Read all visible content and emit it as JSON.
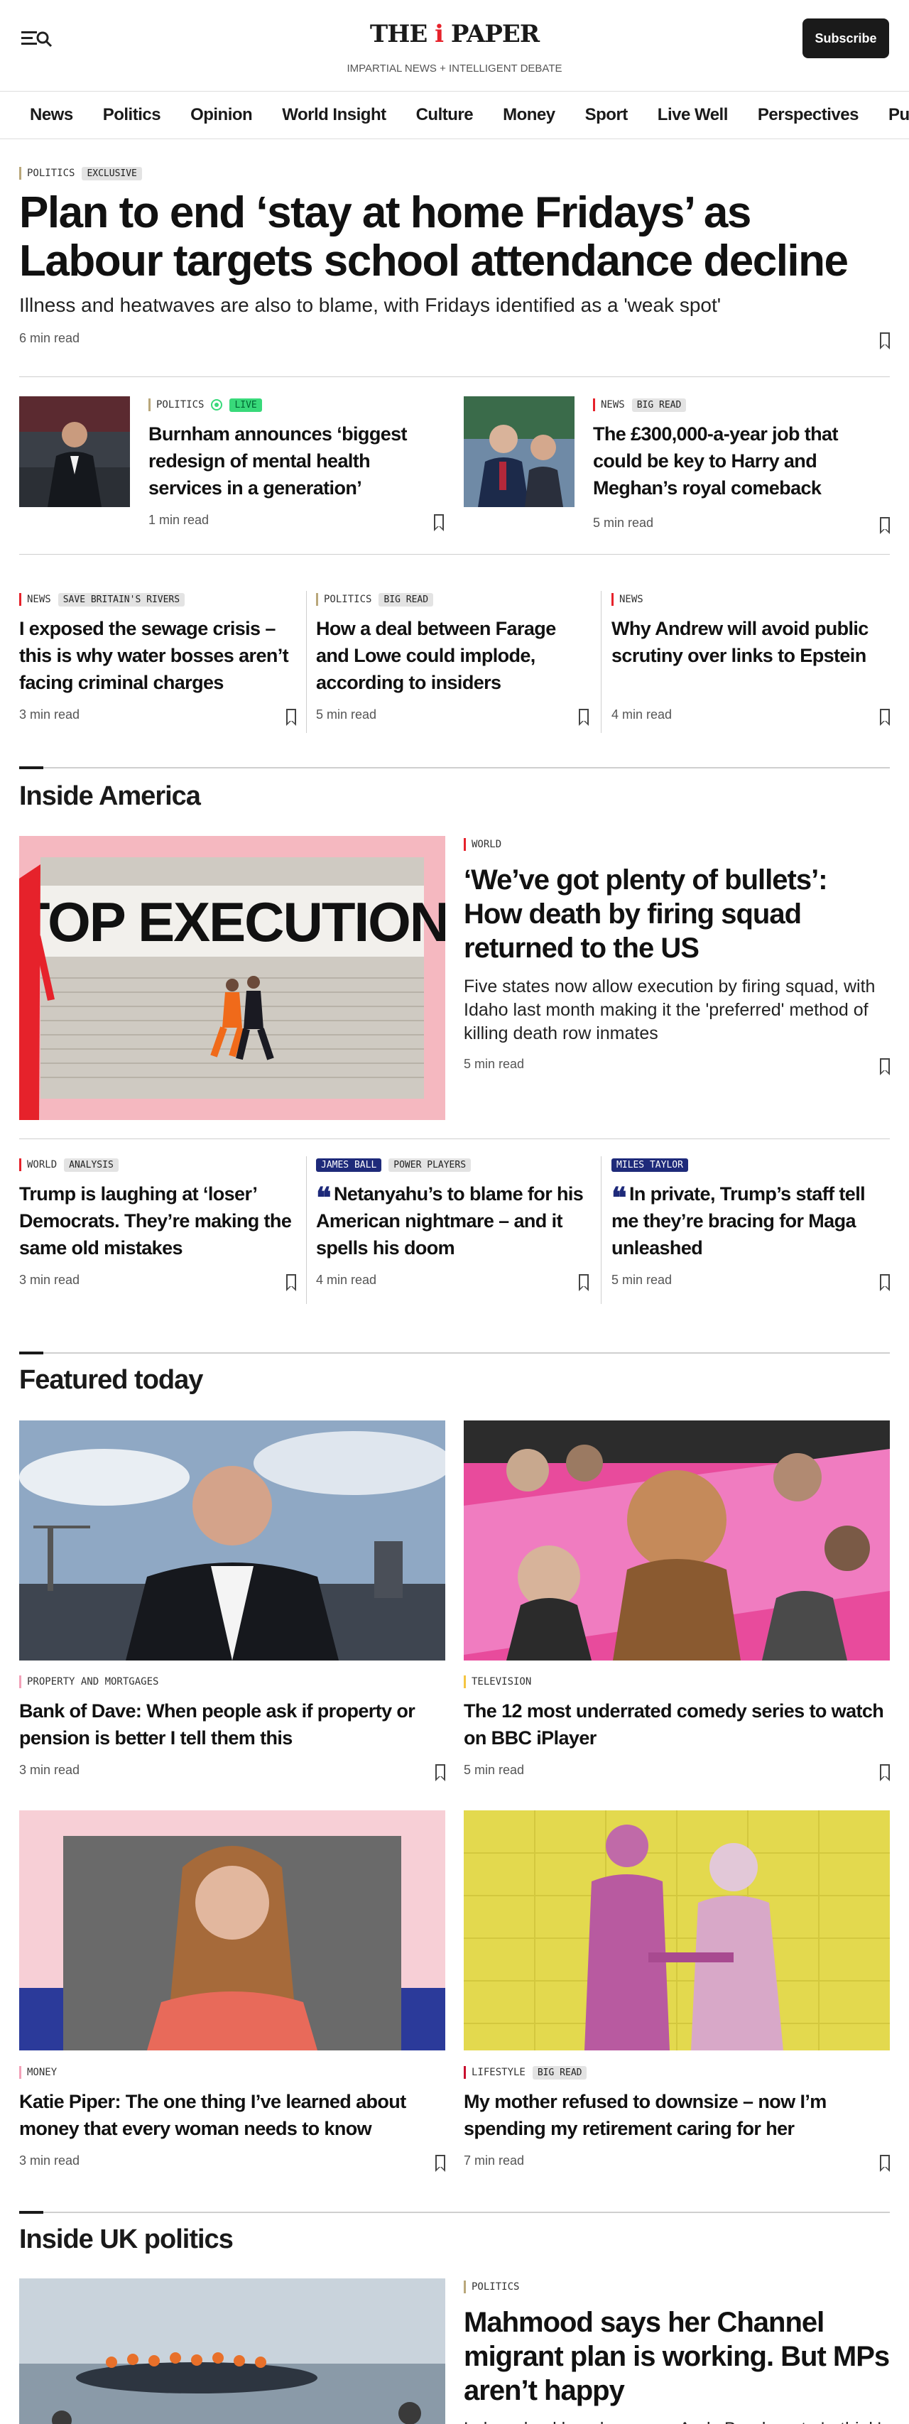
{
  "header": {
    "logo_left": "THE",
    "logo_mid": "i",
    "logo_right": "PAPER",
    "tagline": "IMPARTIAL NEWS + INTELLIGENT DEBATE",
    "subscribe": "Subscribe",
    "menu_icon": "menu-search-icon"
  },
  "nav": [
    "News",
    "Politics",
    "Opinion",
    "World Insight",
    "Culture",
    "Money",
    "Sport",
    "Live Well",
    "Perspectives",
    "Puzzles"
  ],
  "lead": {
    "section": "POLITICS",
    "tag": "EXCLUSIVE",
    "headline": "Plan to end ‘stay at home Fridays’ as Labour targets school attendance decline",
    "standfirst": "Illness and heatwaves are also to blame, with Fridays identified as a 'weak spot'",
    "read": "6 min read"
  },
  "row2": [
    {
      "section": "POLITICS",
      "tag": "LIVE",
      "headline": "Burnham announces ‘biggest redesign of mental health services in a generation’",
      "read": "1 min read"
    },
    {
      "section": "NEWS",
      "tag": "BIG READ",
      "headline": "The £300,000-a-year job that could be key to Harry and Meghan’s royal comeback",
      "read": "5 min read"
    }
  ],
  "row3": [
    {
      "section": "NEWS",
      "tag": "SAVE BRITAIN'S RIVERS",
      "headline": "I exposed the sewage crisis – this is why water bosses aren’t facing criminal charges",
      "read": "3 min read"
    },
    {
      "section": "POLITICS",
      "tag": "BIG READ",
      "headline": "How a deal between Farage and Lowe could implode, according to insiders",
      "read": "5 min read"
    },
    {
      "section": "NEWS",
      "tag": "",
      "headline": "Why Andrew will avoid public scrutiny over links to Epstein",
      "read": "4 min read"
    }
  ],
  "america": {
    "title": "Inside America",
    "image_text": "STOP EXECUTIONS",
    "section": "WORLD",
    "headline": "‘We’ve got plenty of bullets’: How death by firing squad returned to the US",
    "standfirst": "Five states now allow execution by firing squad, with Idaho last month making it the 'preferred' method of killing death row inmates",
    "read": "5 min read"
  },
  "row5": [
    {
      "section": "WORLD",
      "tag": "ANALYSIS",
      "headline": "Trump is laughing at ‘loser’ Democrats. They’re making the same old mistakes",
      "read": "3 min read"
    },
    {
      "author": "JAMES BALL",
      "tag": "POWER PLAYERS",
      "headline": "Netanyahu’s to blame for his American nightmare – and it spells his doom",
      "read": "4 min read"
    },
    {
      "author": "MILES TAYLOR",
      "headline": "In private, Trump’s staff tell me they’re bracing for Maga unleashed",
      "read": "5 min read"
    }
  ],
  "featured": {
    "title": "Featured today",
    "items": [
      {
        "section": "PROPERTY AND MORTGAGES",
        "tag": "",
        "headline": "Bank of Dave: When people ask if property or pension is better I tell them this",
        "read": "3 min read"
      },
      {
        "section": "TELEVISION",
        "tag": "",
        "headline": "The 12 most underrated comedy series to watch on BBC iPlayer",
        "read": "5 min read"
      },
      {
        "section": "MONEY",
        "tag": "",
        "headline": "Katie Piper: The one thing I’ve learned about money that every woman needs to know",
        "read": "3 min read"
      },
      {
        "section": "LIFESTYLE",
        "tag": "BIG READ",
        "headline": "My mother refused to downsize – now I’m spending my retirement caring for her",
        "read": "7 min read"
      }
    ]
  },
  "ukpolitics": {
    "title": "Inside UK politics",
    "section": "POLITICS",
    "headline": "Mahmood says her Channel migrant plan is working. But MPs aren’t happy",
    "standfirst": "Labour backbenchers urge Andy Burnham to 'rethink' Home Secretary's asylum policy"
  },
  "colors": {
    "red": "#e6222b",
    "politics": "#b9a77a",
    "news": "#e6222b",
    "live": "#38d97a",
    "navy": "#1e2a7a",
    "property": "#f2a1b8",
    "tv": "#f5c542",
    "money": "#f2a1b8",
    "lifestyle": "#c8102e"
  }
}
